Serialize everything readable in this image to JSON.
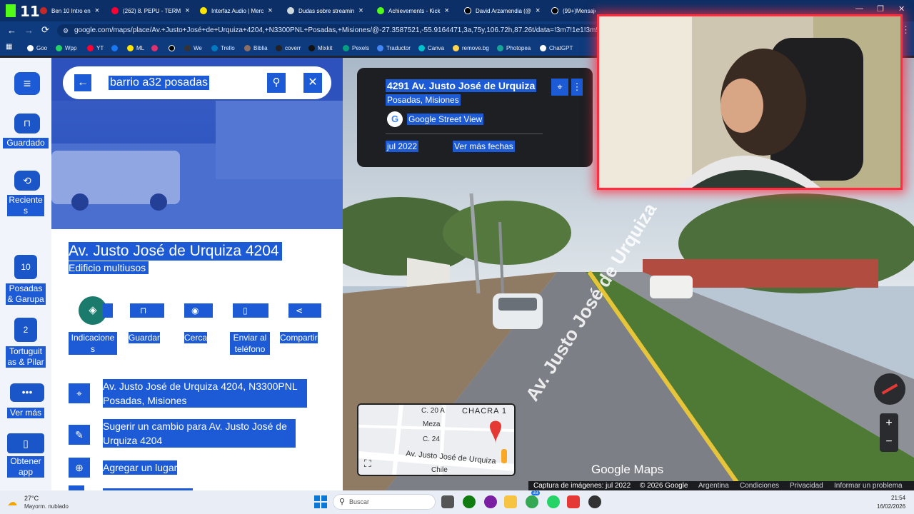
{
  "browser": {
    "tabs": [
      {
        "label": "Ben 10 Intro en",
        "color": "#c62828"
      },
      {
        "label": "(262) 8. PEPU - TERM",
        "color": "#ff0033"
      },
      {
        "label": "Interfaz Audio | Merc",
        "color": "#ffe600"
      },
      {
        "label": "Dudas sobre streamin",
        "color": "#cfd8dc"
      },
      {
        "label": "Achievements - Kick",
        "color": "#53fc18"
      },
      {
        "label": "David Arzamendia (@",
        "color": "#000000"
      },
      {
        "label": "(99+)Mensaje",
        "color": "#000000"
      }
    ],
    "url": "google.com/maps/place/Av.+Justo+José+de+Urquiza+4204,+N3300PNL+Posadas,+Misiones/@-27.3587521,-55.9164471,3a,75y,106.72h,87.26t/data=!3m7!1e1!3m5!1sIM3bv",
    "bookmarks": [
      "Goo",
      "Wpp",
      "YT",
      "",
      "ML",
      "",
      "",
      "We",
      "Trello",
      "Biblia",
      "coverr",
      "Mixkit",
      "Pexels",
      "Traductor",
      "Canva",
      "remove.bg",
      "Photopea",
      "ChatGPT"
    ],
    "overlay_logo": "11"
  },
  "rail": {
    "items": [
      {
        "label": "Guardado"
      },
      {
        "label": "Reciente s"
      },
      {
        "label": "Posadas & Garupa",
        "badge": "10"
      },
      {
        "label": "Tortuguit as & Pilar",
        "badge": "2"
      },
      {
        "label": "Ver más"
      },
      {
        "label": "Obtener app"
      }
    ]
  },
  "panel": {
    "search_value": "barrio a32 posadas",
    "title": "Av. Justo José de Urquiza 4204",
    "subtitle": "Edificio multiusos",
    "actions": [
      {
        "label": "Indicacione s"
      },
      {
        "label": "Guardar"
      },
      {
        "label": "Cerca"
      },
      {
        "label": "Enviar al teléfono"
      },
      {
        "label": "Compartir"
      }
    ],
    "rows": [
      {
        "text": "Av. Justo José de Urquiza 4204, N3300PNL Posadas, Misiones"
      },
      {
        "text": "Sugerir un cambio para Av. Justo José de Urquiza 4204"
      },
      {
        "text": "Agregar un lugar"
      }
    ]
  },
  "streetview": {
    "card_title": "4291 Av. Justo José de Urquiza",
    "card_subtitle": "Posadas, Misiones",
    "provider": "Google Street View",
    "date": "jul 2022",
    "more_dates": "Ver más fechas",
    "road_label": "Av. Justo José de Urquiza",
    "watermark": "Google Maps",
    "footer": [
      "Captura de imágenes: jul 2022",
      "© 2026 Google",
      "Argentina",
      "Condiciones",
      "Privacidad",
      "Informar un problema"
    ],
    "minimap": {
      "labels": [
        "C. 20 A",
        "CHACRA 1",
        "Meza",
        "C. 24",
        "Av. Justo José de Urquiza",
        "Chile"
      ]
    }
  },
  "taskbar": {
    "weather_temp": "27°C",
    "weather_desc": "Mayorm. nublado",
    "search_placeholder": "Buscar",
    "badge_count": "33",
    "time": "21:54",
    "date": "16/02/2026"
  },
  "colors": {
    "accent": "#1c5ad6",
    "selection": "#1c5ad6",
    "cam_border": "#ff2d3d"
  }
}
